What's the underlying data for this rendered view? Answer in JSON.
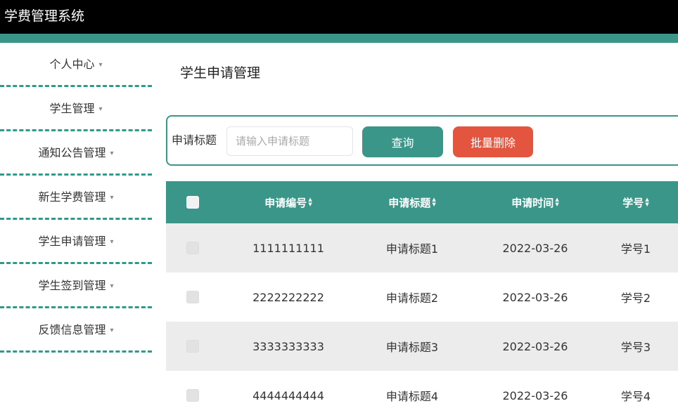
{
  "app": {
    "title": "学费管理系统"
  },
  "colors": {
    "accent": "#3a9688",
    "danger": "#e4553f",
    "topbar": "#000000"
  },
  "sidebar": {
    "items": [
      {
        "label": "个人中心"
      },
      {
        "label": "学生管理"
      },
      {
        "label": "通知公告管理"
      },
      {
        "label": "新生学费管理"
      },
      {
        "label": "学生申请管理"
      },
      {
        "label": "学生签到管理"
      },
      {
        "label": "反馈信息管理"
      }
    ]
  },
  "main": {
    "title": "学生申请管理"
  },
  "search": {
    "label": "申请标题",
    "placeholder": "请输入申请标题",
    "value": "",
    "query_label": "查询",
    "batch_delete_label": "批量删除"
  },
  "table": {
    "headers": {
      "id": "申请编号",
      "title": "申请标题",
      "time": "申请时间",
      "student_no": "学号"
    },
    "rows": [
      {
        "id": "1111111111",
        "title": "申请标题1",
        "time": "2022-03-26",
        "student_no": "学号1"
      },
      {
        "id": "2222222222",
        "title": "申请标题2",
        "time": "2022-03-26",
        "student_no": "学号2"
      },
      {
        "id": "3333333333",
        "title": "申请标题3",
        "time": "2022-03-26",
        "student_no": "学号3"
      },
      {
        "id": "4444444444",
        "title": "申请标题4",
        "time": "2022-03-26",
        "student_no": "学号4"
      }
    ]
  }
}
